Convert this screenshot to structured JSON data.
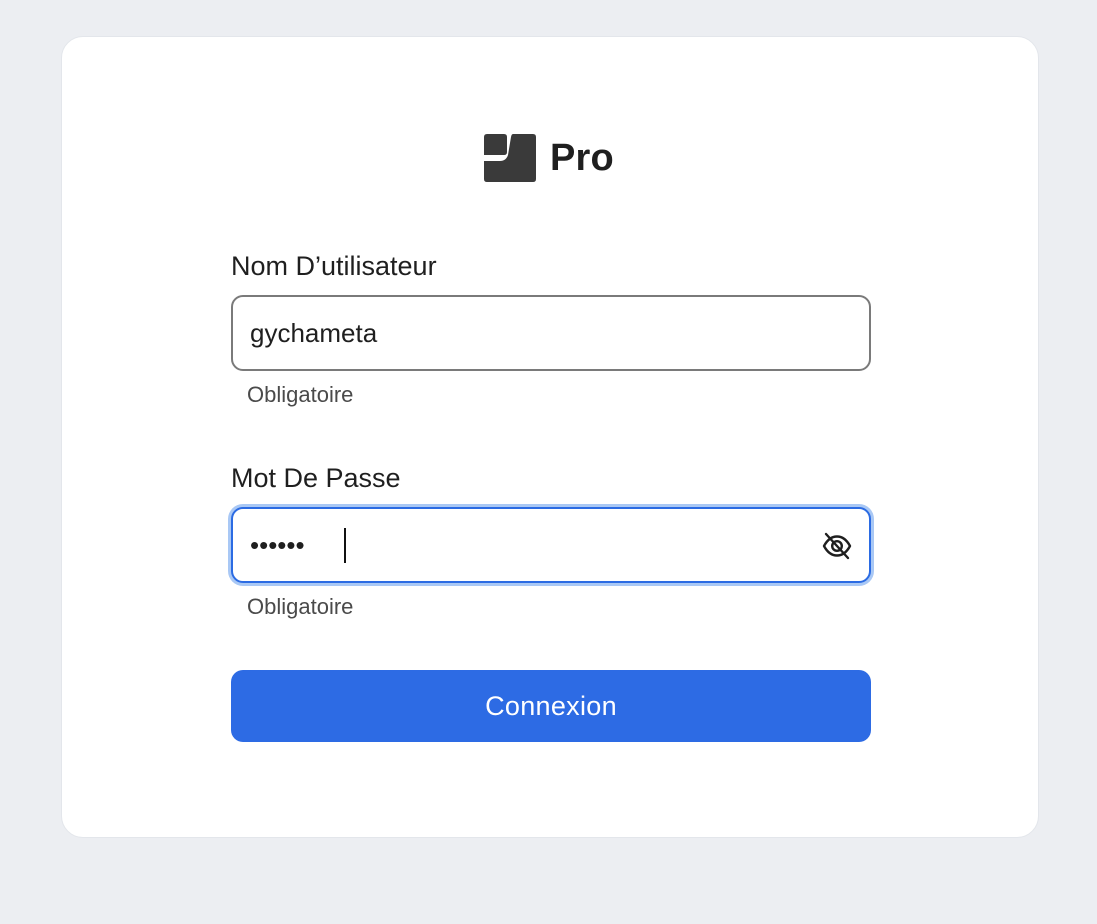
{
  "brand": {
    "logo_icon": "brand-logo-icon",
    "name": "Pro",
    "logo_color": "#3a3a3a"
  },
  "login_form": {
    "username": {
      "label": "Nom D’utilisateur",
      "value": "gychameta",
      "helper": "Obligatoire"
    },
    "password": {
      "label": "Mot De Passe",
      "value": "••••••",
      "helper": "Obligatoire",
      "toggle_icon": "eye-slash-icon",
      "focused": true
    },
    "submit_label": "Connexion"
  },
  "colors": {
    "background": "#eceef2",
    "card": "#ffffff",
    "primary": "#2d6be4",
    "focus_ring": "#a9c8f5",
    "text": "#1f1f1f",
    "helper_text": "#4a4a4a"
  }
}
